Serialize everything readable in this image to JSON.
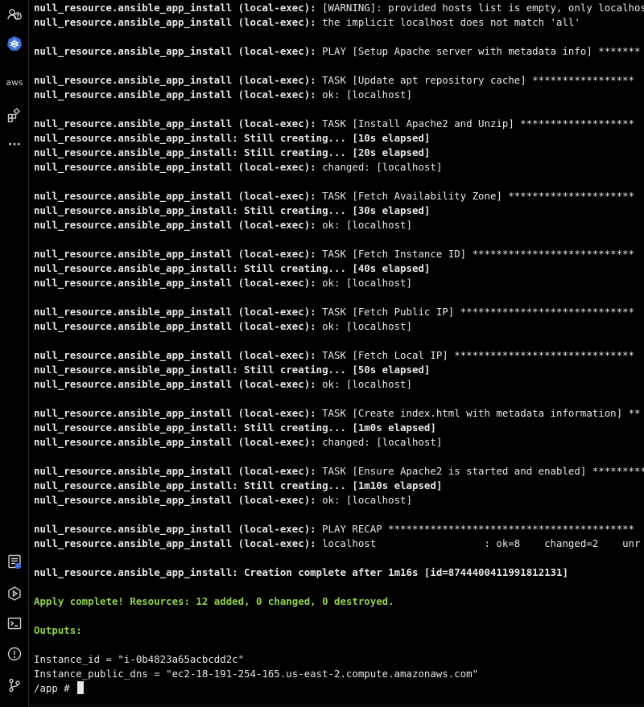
{
  "activity_bar": {
    "top_icons": [
      "accounts-help-icon",
      "kubernetes-icon",
      "aws-icon",
      "extensions-icon",
      "more-icon"
    ],
    "aws_label": "aws",
    "more_label": "···",
    "bottom_icons": [
      "output-panel-icon",
      "run-icon",
      "terminal-icon",
      "problems-icon",
      "source-control-icon"
    ]
  },
  "terminal": {
    "lines": [
      {
        "prefix": "null_resource.ansible_app_install (local-exec):",
        "text": " [WARNING]: provided hosts list is empty, only localhos",
        "style": "normal"
      },
      {
        "prefix": "null_resource.ansible_app_install (local-exec):",
        "text": " the implicit localhost does not match 'all'",
        "style": "normal"
      },
      {
        "prefix": "",
        "text": "",
        "style": "blank"
      },
      {
        "prefix": "null_resource.ansible_app_install (local-exec):",
        "text": " PLAY [Setup Apache server with metadata info] *******",
        "style": "normal"
      },
      {
        "prefix": "",
        "text": "",
        "style": "blank"
      },
      {
        "prefix": "null_resource.ansible_app_install (local-exec):",
        "text": " TASK [Update apt repository cache] *****************",
        "style": "normal"
      },
      {
        "prefix": "null_resource.ansible_app_install (local-exec):",
        "text": " ok: [localhost]",
        "style": "normal"
      },
      {
        "prefix": "",
        "text": "",
        "style": "blank"
      },
      {
        "prefix": "null_resource.ansible_app_install (local-exec):",
        "text": " TASK [Install Apache2 and Unzip] *******************",
        "style": "normal"
      },
      {
        "prefix": "null_resource.ansible_app_install:",
        "text": " Still creating... [10s elapsed]",
        "style": "bold"
      },
      {
        "prefix": "null_resource.ansible_app_install:",
        "text": " Still creating... [20s elapsed]",
        "style": "bold"
      },
      {
        "prefix": "null_resource.ansible_app_install (local-exec):",
        "text": " changed: [localhost]",
        "style": "normal"
      },
      {
        "prefix": "",
        "text": "",
        "style": "blank"
      },
      {
        "prefix": "null_resource.ansible_app_install (local-exec):",
        "text": " TASK [Fetch Availability Zone] *********************",
        "style": "normal"
      },
      {
        "prefix": "null_resource.ansible_app_install:",
        "text": " Still creating... [30s elapsed]",
        "style": "bold"
      },
      {
        "prefix": "null_resource.ansible_app_install (local-exec):",
        "text": " ok: [localhost]",
        "style": "normal"
      },
      {
        "prefix": "",
        "text": "",
        "style": "blank"
      },
      {
        "prefix": "null_resource.ansible_app_install (local-exec):",
        "text": " TASK [Fetch Instance ID] ***************************",
        "style": "normal"
      },
      {
        "prefix": "null_resource.ansible_app_install:",
        "text": " Still creating... [40s elapsed]",
        "style": "bold"
      },
      {
        "prefix": "null_resource.ansible_app_install (local-exec):",
        "text": " ok: [localhost]",
        "style": "normal"
      },
      {
        "prefix": "",
        "text": "",
        "style": "blank"
      },
      {
        "prefix": "null_resource.ansible_app_install (local-exec):",
        "text": " TASK [Fetch Public IP] *****************************",
        "style": "normal"
      },
      {
        "prefix": "null_resource.ansible_app_install (local-exec):",
        "text": " ok: [localhost]",
        "style": "normal"
      },
      {
        "prefix": "",
        "text": "",
        "style": "blank"
      },
      {
        "prefix": "null_resource.ansible_app_install (local-exec):",
        "text": " TASK [Fetch Local IP] ******************************",
        "style": "normal"
      },
      {
        "prefix": "null_resource.ansible_app_install:",
        "text": " Still creating... [50s elapsed]",
        "style": "bold"
      },
      {
        "prefix": "null_resource.ansible_app_install (local-exec):",
        "text": " ok: [localhost]",
        "style": "normal"
      },
      {
        "prefix": "",
        "text": "",
        "style": "blank"
      },
      {
        "prefix": "null_resource.ansible_app_install (local-exec):",
        "text": " TASK [Create index.html with metadata information] **",
        "style": "normal"
      },
      {
        "prefix": "null_resource.ansible_app_install:",
        "text": " Still creating... [1m0s elapsed]",
        "style": "bold"
      },
      {
        "prefix": "null_resource.ansible_app_install (local-exec):",
        "text": " changed: [localhost]",
        "style": "normal"
      },
      {
        "prefix": "",
        "text": "",
        "style": "blank"
      },
      {
        "prefix": "null_resource.ansible_app_install (local-exec):",
        "text": " TASK [Ensure Apache2 is started and enabled] *********",
        "style": "normal"
      },
      {
        "prefix": "null_resource.ansible_app_install:",
        "text": " Still creating... [1m10s elapsed]",
        "style": "bold"
      },
      {
        "prefix": "null_resource.ansible_app_install (local-exec):",
        "text": " ok: [localhost]",
        "style": "normal"
      },
      {
        "prefix": "",
        "text": "",
        "style": "blank"
      },
      {
        "prefix": "null_resource.ansible_app_install (local-exec):",
        "text": " PLAY RECAP *****************************************",
        "style": "normal"
      },
      {
        "prefix": "null_resource.ansible_app_install (local-exec):",
        "text": " localhost                  : ok=8    changed=2    unr",
        "style": "normal"
      },
      {
        "prefix": "",
        "text": "",
        "style": "blank"
      },
      {
        "prefix": "null_resource.ansible_app_install:",
        "text": " Creation complete after 1m16s [id=8744400411991812131]",
        "style": "bold"
      },
      {
        "prefix": "",
        "text": "",
        "style": "blank"
      },
      {
        "prefix": "",
        "text": "Apply complete! Resources: 12 added, 0 changed, 0 destroyed.",
        "style": "green-bold"
      },
      {
        "prefix": "",
        "text": "",
        "style": "blank"
      },
      {
        "prefix": "",
        "text": "Outputs:",
        "style": "green"
      },
      {
        "prefix": "",
        "text": "",
        "style": "blank"
      },
      {
        "prefix": "",
        "text": "Instance_id = \"i-0b4823a65acbcdd2c\"",
        "style": "plain"
      },
      {
        "prefix": "",
        "text": "Instance_public_dns = \"ec2-18-191-254-165.us-east-2.compute.amazonaws.com\"",
        "style": "plain"
      }
    ],
    "prompt": "/app # "
  },
  "colors": {
    "background": "#000000",
    "foreground": "#e6e6e6",
    "success_green": "#8fd14f",
    "icon_grey": "#cccccc"
  }
}
